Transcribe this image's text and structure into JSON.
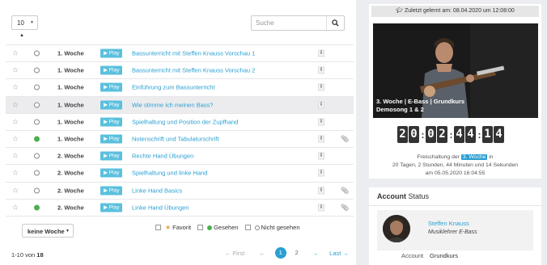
{
  "table": {
    "page_size": "10",
    "search_placeholder": "Suche",
    "rows": [
      {
        "week": "1. Woche",
        "play": "▶ Play",
        "title": "Bassunterricht mit Steffen Knauss Vorschau 1",
        "seen": false,
        "attachment": false,
        "highlight": false
      },
      {
        "week": "1. Woche",
        "play": "▶ Play",
        "title": "Bassunterricht mit Steffen Knauss Vorschau 2",
        "seen": false,
        "attachment": false,
        "highlight": false
      },
      {
        "week": "1. Woche",
        "play": "▶ Play",
        "title": "Einführung zum Bassunterricht",
        "seen": false,
        "attachment": false,
        "highlight": false
      },
      {
        "week": "1. Woche",
        "play": "▶ Play",
        "title": "Wie stimme ich meinen Bass?",
        "seen": false,
        "attachment": false,
        "highlight": true
      },
      {
        "week": "1. Woche",
        "play": "▶ Play",
        "title": "Spielhaltung und Position der Zupfhand",
        "seen": false,
        "attachment": false,
        "highlight": false
      },
      {
        "week": "1. Woche",
        "play": "▶ Play",
        "title": "Notenschrift und Tabulaturschrift",
        "seen": true,
        "attachment": true,
        "highlight": false
      },
      {
        "week": "2. Woche",
        "play": "▶ Play",
        "title": "Rechte Hand Übungen",
        "seen": false,
        "attachment": false,
        "highlight": false
      },
      {
        "week": "2. Woche",
        "play": "▶ Play",
        "title": "Spielhaltung und linke Hand",
        "seen": false,
        "attachment": false,
        "highlight": false
      },
      {
        "week": "2. Woche",
        "play": "▶ Play",
        "title": "Linke Hand Basics",
        "seen": false,
        "attachment": true,
        "highlight": false
      },
      {
        "week": "2. Woche",
        "play": "▶ Play",
        "title": "Linke Hand Übungen",
        "seen": true,
        "attachment": true,
        "highlight": false
      }
    ],
    "info_glyph": "i"
  },
  "filter": {
    "week_select": "keine Woche",
    "legend_favorit": "Favorit",
    "legend_gesehen": "Gesehen",
    "legend_nicht_gesehen": "Nicht gesehen"
  },
  "pagination": {
    "range_prefix": "1-10",
    "range_mid": " von ",
    "range_total": "18",
    "first": "← First",
    "prev": "←",
    "pages": [
      "1",
      "2"
    ],
    "active_page": 1,
    "next": "→",
    "last": "Last →"
  },
  "sidebar": {
    "last_learned": "Zuletzt gelernt am: 08.04.2020 um 12:08:00",
    "video_caption_line1": "3. Woche | E-Bass | Grundkurs",
    "video_caption_line2": "Demosong 1 & 2",
    "countdown": {
      "h1": "2",
      "h2": "0",
      "m1": "0",
      "m2": "2",
      "s1": "4",
      "s2": "4",
      "t1": "1",
      "t2": "4"
    },
    "unlock_prefix": "Freischaltung der",
    "unlock_badge": "3. Woche",
    "unlock_suffix": "in",
    "unlock_line2": "20 Tagen, 2 Stunden, 44 Minuten und 14 Sekunden",
    "unlock_line3": "am 05.05.2020 16:04:55"
  },
  "account": {
    "heading_bold": "Account",
    "heading_rest": " Status",
    "name": "Steffen Knauss",
    "role": "Musiklehrer E-Bass",
    "field_label": "Account",
    "field_value": "Grundkurs"
  },
  "colors": {
    "accent": "#2aa0d2",
    "play_button": "#5bc0de",
    "seen_dot": "#4caf50",
    "favorit_star": "#e8a13a"
  }
}
